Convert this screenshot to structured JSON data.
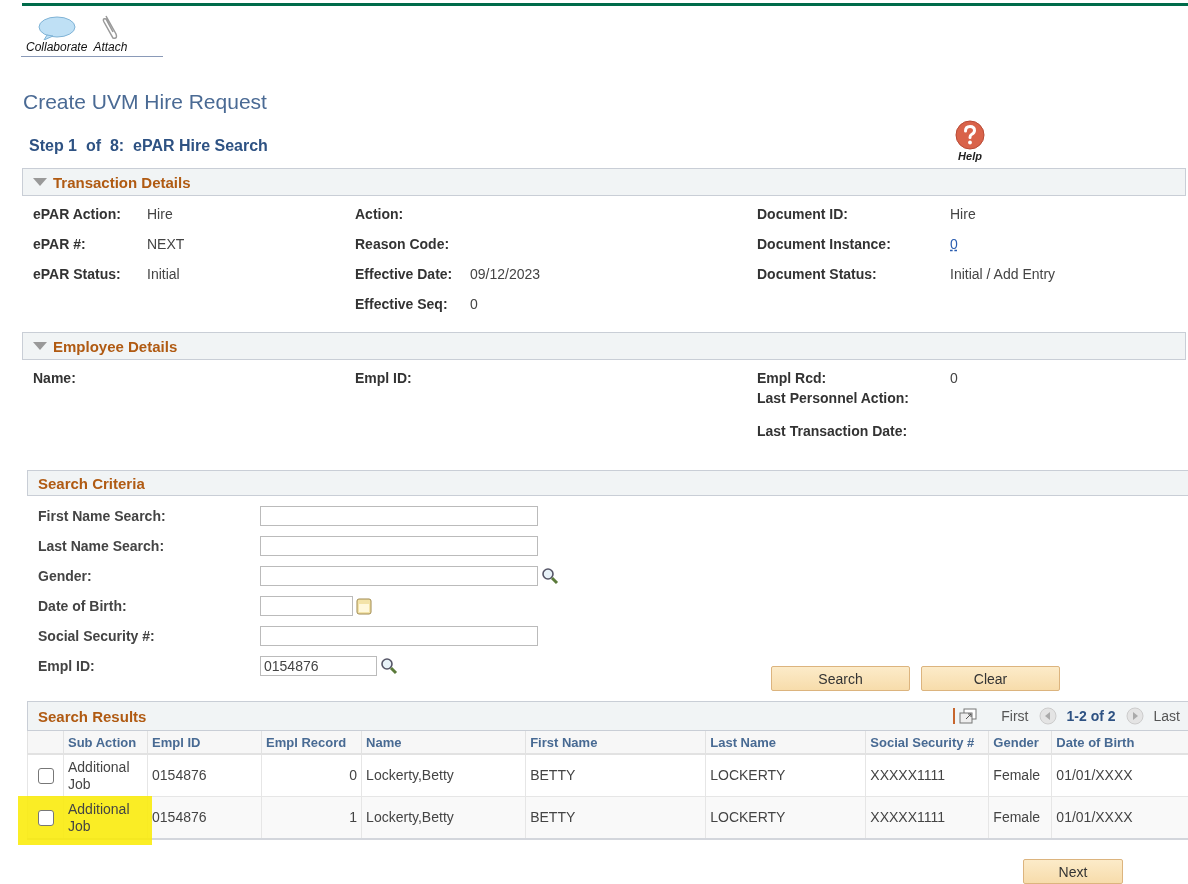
{
  "toolbar": [
    {
      "label": "Collaborate",
      "kind": "collaborate"
    },
    {
      "label": "Attach",
      "kind": "attach"
    }
  ],
  "title": "Create UVM Hire Request",
  "step": "Step 1  of  8:  ePAR Hire Search",
  "help": {
    "label": "Help"
  },
  "transaction": {
    "title": "Transaction Details",
    "expanded": true,
    "columns": [
      [
        {
          "label": "ePAR Action:",
          "value": "Hire"
        },
        {
          "label": "ePAR #:",
          "value": "NEXT"
        },
        {
          "label": "ePAR Status:",
          "value": "Initial"
        }
      ],
      [
        {
          "label": "Action:"
        },
        {
          "label": "Reason Code:"
        },
        {
          "label": "Effective Date:",
          "value": "09/12/2023"
        },
        {
          "label": "Effective Seq:",
          "value": "0"
        }
      ],
      [
        {
          "label": "Document ID:",
          "value": "Hire"
        },
        {
          "label": "Document Instance:",
          "value": "0",
          "kind": "link"
        },
        {
          "label": "Document Status:",
          "value": "Initial / Add Entry"
        }
      ]
    ]
  },
  "employee": {
    "title": "Employee Details",
    "expanded": true,
    "columns": [
      [
        {
          "label": "Name:"
        }
      ],
      [
        {
          "label": "Empl ID:"
        }
      ],
      [
        {
          "label": "Empl Rcd:",
          "value": "0"
        },
        {
          "label": "Last Personnel Action:"
        },
        {
          "label": "Last Transaction Date:"
        }
      ]
    ]
  },
  "criteria": {
    "title": "Search Criteria",
    "fields": [
      {
        "label": "First Name Search:",
        "kind": "text"
      },
      {
        "label": "Last Name Search:",
        "kind": "text"
      },
      {
        "label": "Gender:",
        "kind": "lookup"
      },
      {
        "label": "Date of Birth:",
        "kind": "date"
      },
      {
        "label": "Social Security #:",
        "kind": "text"
      },
      {
        "label": "Empl ID:",
        "kind": "short-lookup",
        "value": "0154876"
      }
    ],
    "buttons": [
      "Search",
      "Clear"
    ]
  },
  "results": {
    "title": "Search Results",
    "first": "First",
    "range": "1-2 of 2",
    "last": "Last",
    "columns": [
      "Sub Action",
      "Empl ID",
      "Empl Record",
      "Name",
      "First Name",
      "Last Name",
      "Social Security #",
      "Gender",
      "Date of Birth"
    ],
    "rows": [
      {
        "checked": false,
        "highlighted": false,
        "cells": [
          "Additional Job",
          "0154876",
          "0",
          "Lockerty,Betty",
          "BETTY",
          "LOCKERTY",
          "XXXXX1111",
          "Female",
          "01/01/XXXX"
        ]
      },
      {
        "checked": false,
        "highlighted": true,
        "cells": [
          "Additional Job",
          "0154876",
          "1",
          "Lockerty,Betty",
          "BETTY",
          "LOCKERTY",
          "XXXXX1111",
          "Female",
          "01/01/XXXX"
        ]
      }
    ]
  },
  "next": "Next"
}
